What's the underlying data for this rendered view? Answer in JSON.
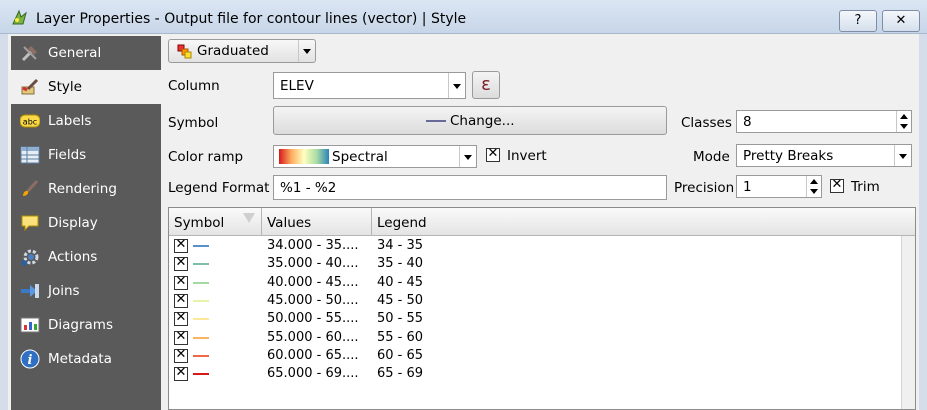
{
  "window": {
    "title": "Layer Properties - Output file for contour lines (vector) | Style",
    "help_label": "?",
    "close_label": "✕"
  },
  "sidebar": {
    "items": [
      {
        "label": "General",
        "icon": "tools-icon"
      },
      {
        "label": "Style",
        "icon": "brush-icon"
      },
      {
        "label": "Labels",
        "icon": "abc-label-icon"
      },
      {
        "label": "Fields",
        "icon": "table-icon"
      },
      {
        "label": "Rendering",
        "icon": "paintbrush-icon"
      },
      {
        "label": "Display",
        "icon": "speech-bubble-icon"
      },
      {
        "label": "Actions",
        "icon": "gear-icon"
      },
      {
        "label": "Joins",
        "icon": "join-arrow-icon"
      },
      {
        "label": "Diagrams",
        "icon": "chart-icon"
      },
      {
        "label": "Metadata",
        "icon": "info-icon"
      }
    ],
    "active": "Style"
  },
  "renderer": {
    "value": "Graduated"
  },
  "column": {
    "label": "Column",
    "value": "ELEV",
    "expression_label": "ε"
  },
  "symbol": {
    "label": "Symbol",
    "button_label": "Change..."
  },
  "classes": {
    "label": "Classes",
    "value": "8"
  },
  "color_ramp": {
    "label": "Color ramp",
    "value": "Spectral",
    "invert_label": "Invert",
    "invert_checked": true
  },
  "mode": {
    "label": "Mode",
    "value": "Pretty Breaks"
  },
  "legend_format": {
    "label": "Legend Format",
    "value": "%1 - %2"
  },
  "precision": {
    "label": "Precision",
    "value": "1",
    "trim_label": "Trim",
    "trim_checked": true
  },
  "table": {
    "headers": [
      "Symbol",
      "Values",
      "Legend"
    ],
    "rows": [
      {
        "values": "34.000 - 35....",
        "legend": "34 - 35",
        "color": "#5b8fc9"
      },
      {
        "values": "35.000 - 40....",
        "legend": "35 - 40",
        "color": "#7cc0a8"
      },
      {
        "values": "40.000 - 45....",
        "legend": "40 - 45",
        "color": "#a5d9a0"
      },
      {
        "values": "45.000 - 50....",
        "legend": "45 - 50",
        "color": "#e8f2a8"
      },
      {
        "values": "50.000 - 55....",
        "legend": "50 - 55",
        "color": "#fde89a"
      },
      {
        "values": "55.000 - 60....",
        "legend": "55 - 60",
        "color": "#fbb463"
      },
      {
        "values": "60.000 - 65....",
        "legend": "60 - 65",
        "color": "#ef6a45"
      },
      {
        "values": "65.000 - 69....",
        "legend": "65 - 69",
        "color": "#d7191c"
      }
    ]
  }
}
